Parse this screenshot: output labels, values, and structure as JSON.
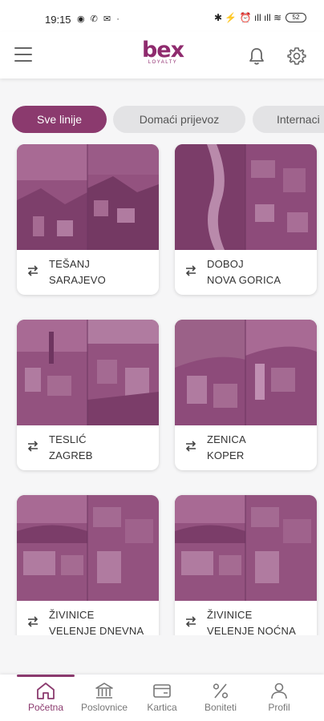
{
  "status_bar": {
    "time": "19:15",
    "left_icons": "◉ ✆ ✉ ·",
    "right_icons": "✱ ⚡ ⏰ ıll ıll ≋",
    "battery": "52"
  },
  "header": {
    "logo_main": "bex",
    "logo_sub": "LOYALTY"
  },
  "tabs": [
    {
      "label": "Sve linije",
      "active": true
    },
    {
      "label": "Domaći prijevoz",
      "active": false
    },
    {
      "label": "Internaci",
      "active": false
    }
  ],
  "routes": [
    {
      "from": "TEŠANJ",
      "to": "SARAJEVO"
    },
    {
      "from": "DOBOJ",
      "to": "NOVA GORICA"
    },
    {
      "from": "TESLIĆ",
      "to": "ZAGREB"
    },
    {
      "from": "ZENICA",
      "to": "KOPER"
    },
    {
      "from": "ŽIVINICE",
      "to": "VELENJE DNEVNA"
    },
    {
      "from": "ŽIVINICE",
      "to": "VELENJE NOĆNA"
    }
  ],
  "nav": [
    {
      "label": "Početna",
      "icon": "home-icon",
      "active": true
    },
    {
      "label": "Poslovnice",
      "icon": "bank-icon",
      "active": false
    },
    {
      "label": "Kartica",
      "icon": "card-icon",
      "active": false
    },
    {
      "label": "Boniteti",
      "icon": "percent-icon",
      "active": false
    },
    {
      "label": "Profil",
      "icon": "user-icon",
      "active": false
    }
  ],
  "colors": {
    "brand": "#8b3a6e",
    "image_tint": "#8a4a76"
  }
}
